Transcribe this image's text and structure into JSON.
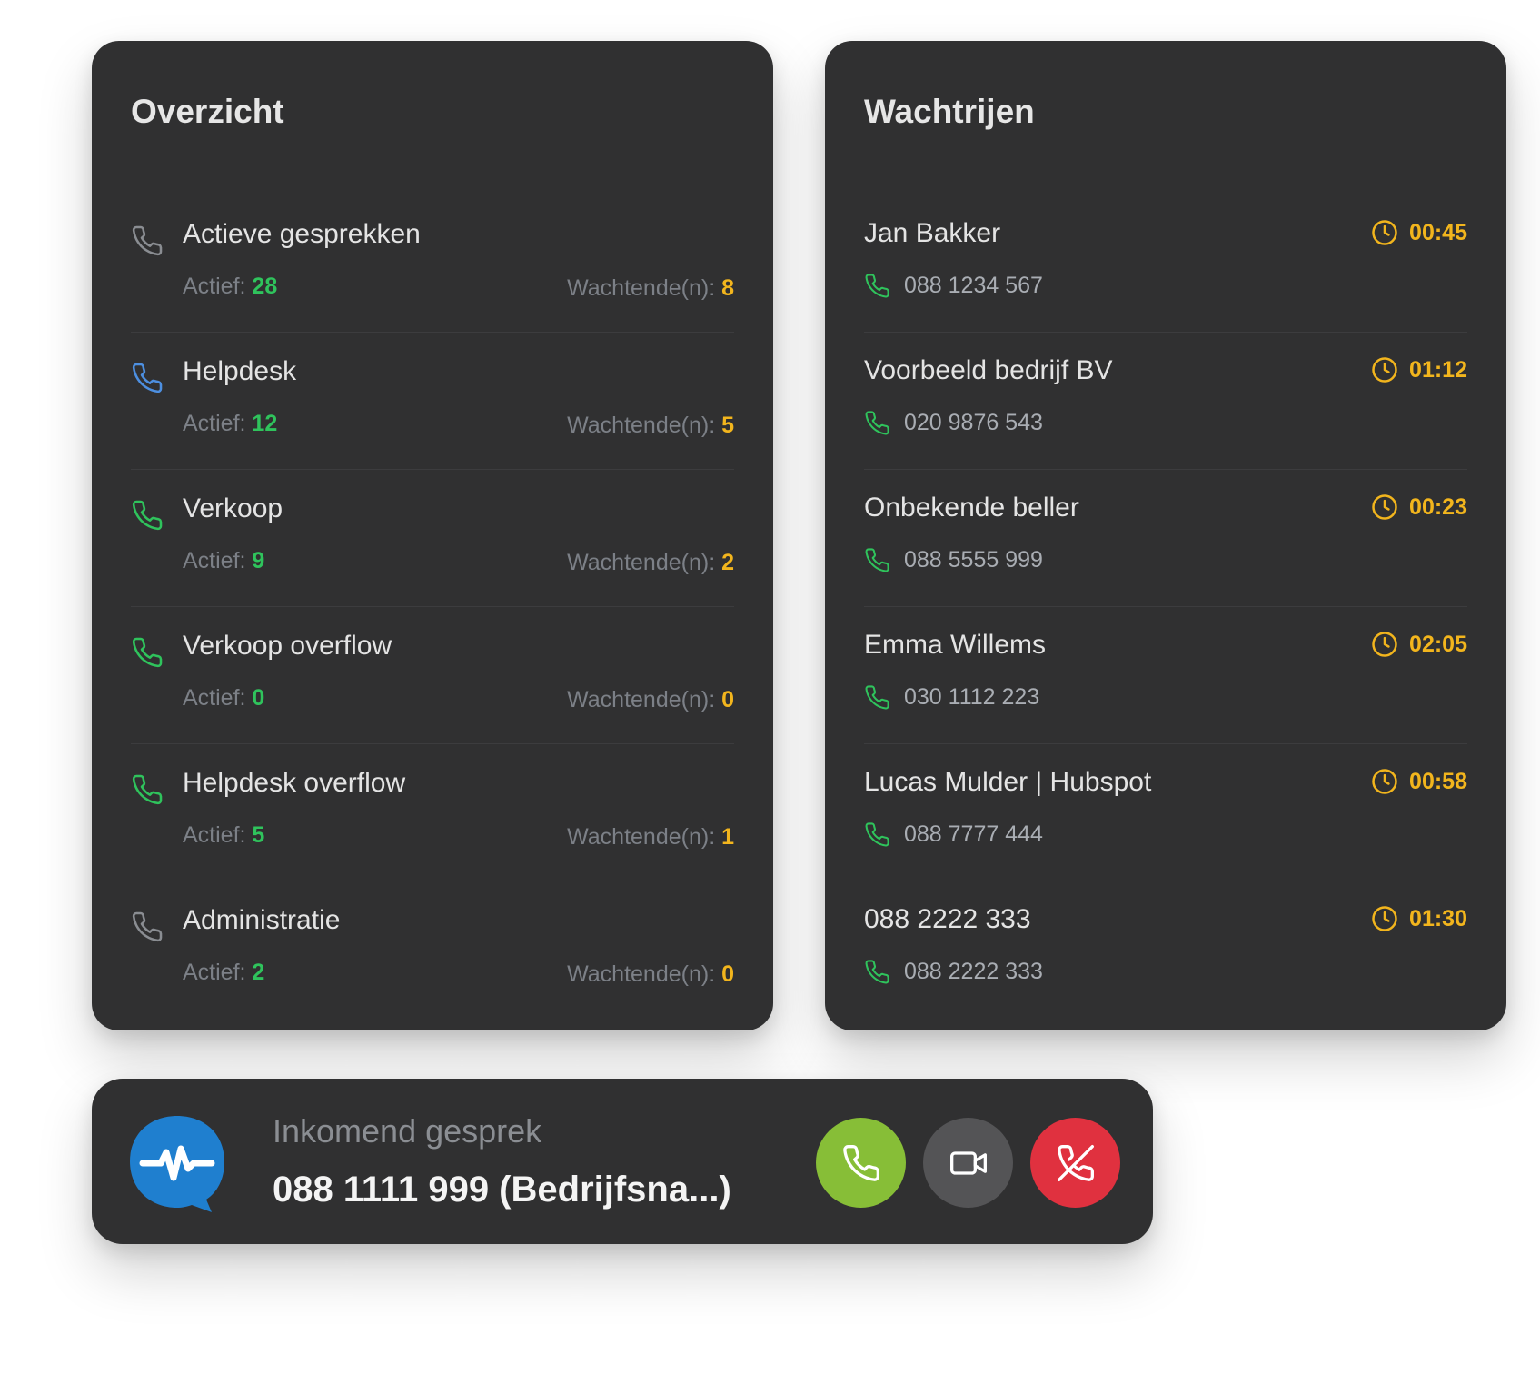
{
  "overview": {
    "title": "Overzicht",
    "active_label": "Actief: ",
    "waiting_label": "Wachtende(n): ",
    "rows": [
      {
        "name": "Actieve gesprekken",
        "active": "28",
        "waiting": "8",
        "icon": "phone-icon",
        "icon_color": "#8a8d92"
      },
      {
        "name": "Helpdesk",
        "active": "12",
        "waiting": "5",
        "icon": "phone-icon",
        "icon_color": "#4d8fe0"
      },
      {
        "name": "Verkoop",
        "active": "9",
        "waiting": "2",
        "icon": "phone-icon",
        "icon_color": "#2fc35c"
      },
      {
        "name": "Verkoop overflow",
        "active": "0",
        "waiting": "0",
        "icon": "phone-icon",
        "icon_color": "#2fc35c"
      },
      {
        "name": "Helpdesk overflow",
        "active": "5",
        "waiting": "1",
        "icon": "phone-icon",
        "icon_color": "#2fc35c"
      },
      {
        "name": "Administratie",
        "active": "2",
        "waiting": "0",
        "icon": "phone-icon",
        "icon_color": "#8a8d92"
      }
    ]
  },
  "queues": {
    "title": "Wachtrijen",
    "rows": [
      {
        "name": "Jan Bakker",
        "time": "00:45",
        "number": "088 1234 567"
      },
      {
        "name": "Voorbeeld bedrijf BV",
        "time": "01:12",
        "number": "020 9876 543"
      },
      {
        "name": "Onbekende beller",
        "time": "00:23",
        "number": "088 5555 999"
      },
      {
        "name": "Emma Willems",
        "time": "02:05",
        "number": "030 1112 223"
      },
      {
        "name": "Lucas Mulder | Hubspot",
        "time": "00:58",
        "number": "088 7777 444"
      },
      {
        "name": "088 2222 333",
        "time": "01:30",
        "number": "088 2222 333"
      }
    ]
  },
  "incoming": {
    "label": "Inkomend gesprek",
    "number": "088 1111 999 (Bedrijfsna...)",
    "logo_icon": "waveform-chat-icon",
    "buttons": {
      "accept": {
        "icon": "phone-icon",
        "color": "#87be37"
      },
      "video": {
        "icon": "video-camera-icon",
        "color": "#545456"
      },
      "decline": {
        "icon": "phone-off-icon",
        "color": "#e0313f"
      }
    }
  },
  "colors": {
    "panel": "#303031",
    "green": "#2fc35c",
    "yellow": "#f2b51d",
    "brand_blue": "#1f7fcf"
  }
}
